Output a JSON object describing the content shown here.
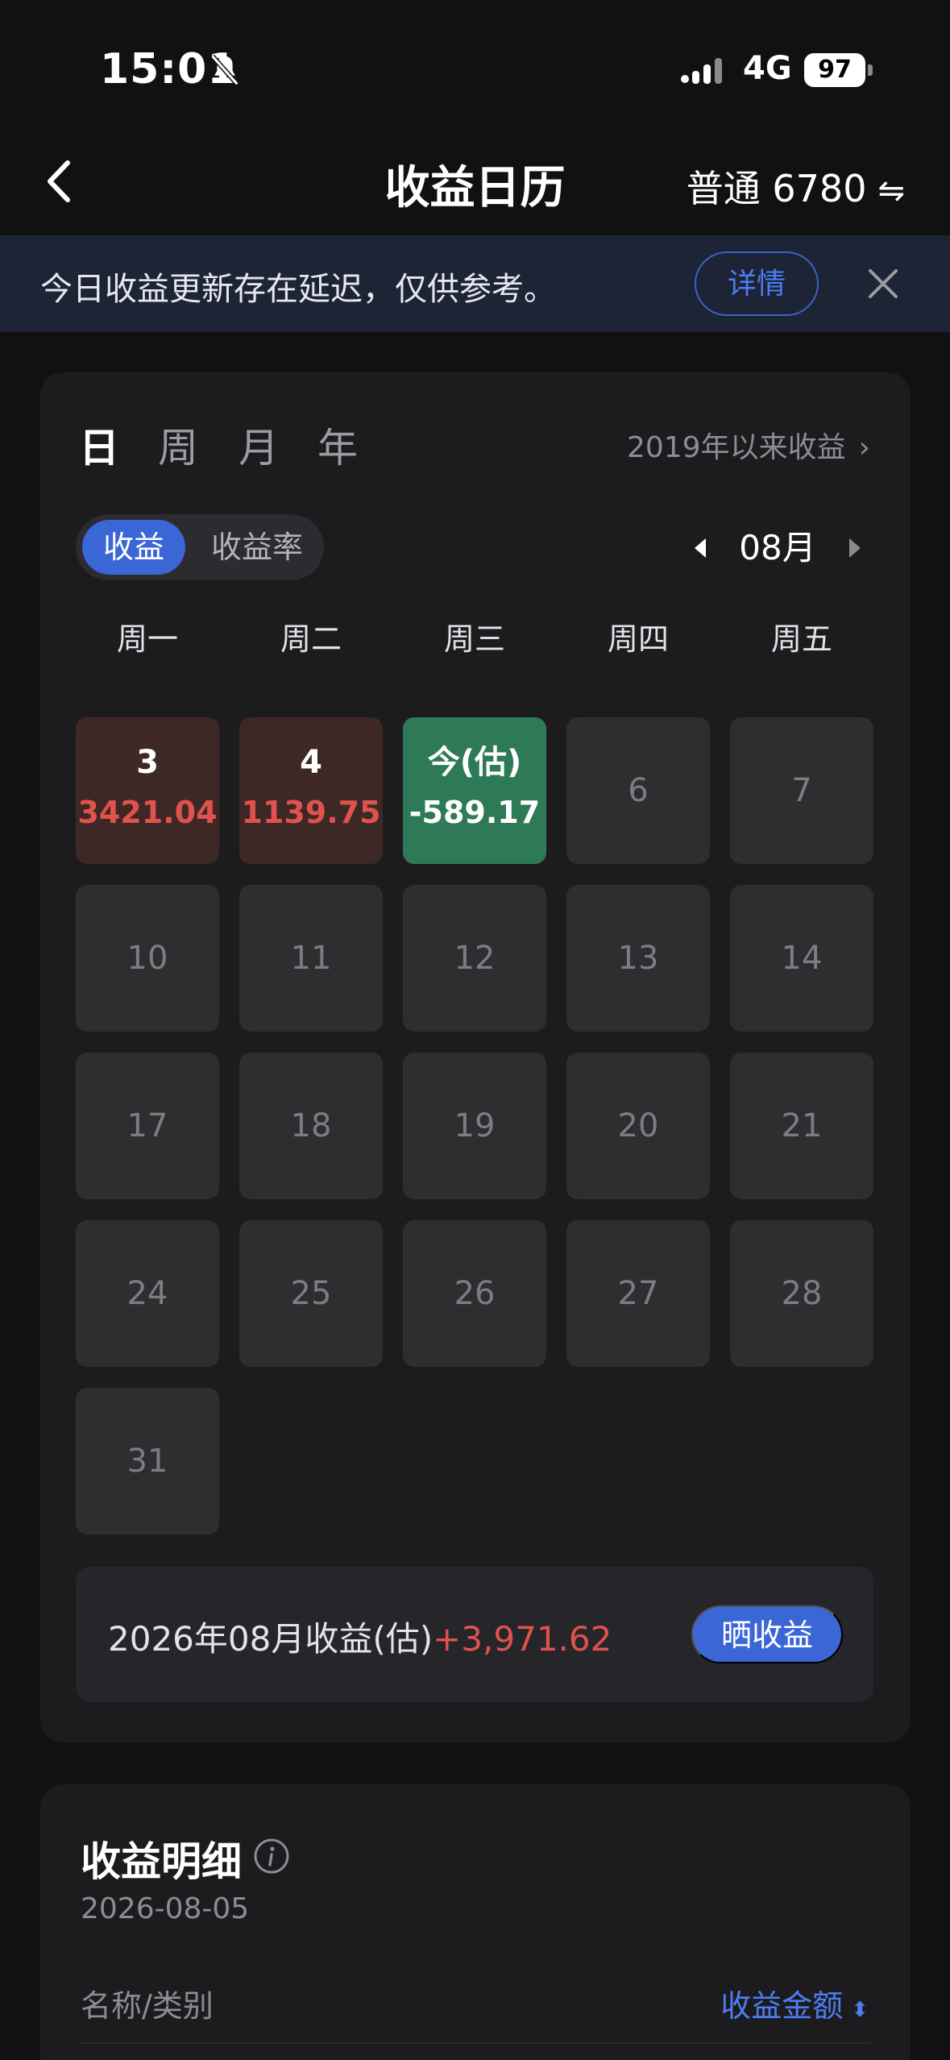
{
  "status_bar": {
    "time": "15:01",
    "network": "4G",
    "battery": "97"
  },
  "nav": {
    "title": "收益日历",
    "account": "普通 6780",
    "swap_symbol": "⇋"
  },
  "notice": {
    "text": "今日收益更新存在延迟，仅供参考。",
    "detail_label": "详情"
  },
  "calendar": {
    "period_tabs": [
      "日",
      "周",
      "月",
      "年"
    ],
    "active_period": "日",
    "since_link": "2019年以来收益",
    "toggle": [
      "收益",
      "收益率"
    ],
    "active_toggle": "收益",
    "month": "08月",
    "weekdays": [
      "周一",
      "周二",
      "周三",
      "周四",
      "周五"
    ],
    "days": [
      {
        "label": "3",
        "value": "3421.04",
        "type": "gain"
      },
      {
        "label": "4",
        "value": "1139.75",
        "type": "gain"
      },
      {
        "label": "今(估)",
        "value": "-589.17",
        "type": "loss"
      },
      {
        "label": "6"
      },
      {
        "label": "7"
      },
      {
        "label": "10"
      },
      {
        "label": "11"
      },
      {
        "label": "12"
      },
      {
        "label": "13"
      },
      {
        "label": "14"
      },
      {
        "label": "17"
      },
      {
        "label": "18"
      },
      {
        "label": "19"
      },
      {
        "label": "20"
      },
      {
        "label": "21"
      },
      {
        "label": "24"
      },
      {
        "label": "25"
      },
      {
        "label": "26"
      },
      {
        "label": "27"
      },
      {
        "label": "28"
      },
      {
        "label": "31"
      }
    ],
    "summary": {
      "text": "2026年08月收益(估)",
      "amount": "+3,971.62",
      "share_label": "晒收益"
    }
  },
  "details": {
    "title": "收益明细",
    "date": "2026-08-05",
    "col_name": "名称/类别",
    "col_amount": "收益金额"
  },
  "colors": {
    "accent": "#3a66d6",
    "gain": "#e0524c",
    "loss_bg": "#2e7a57"
  }
}
